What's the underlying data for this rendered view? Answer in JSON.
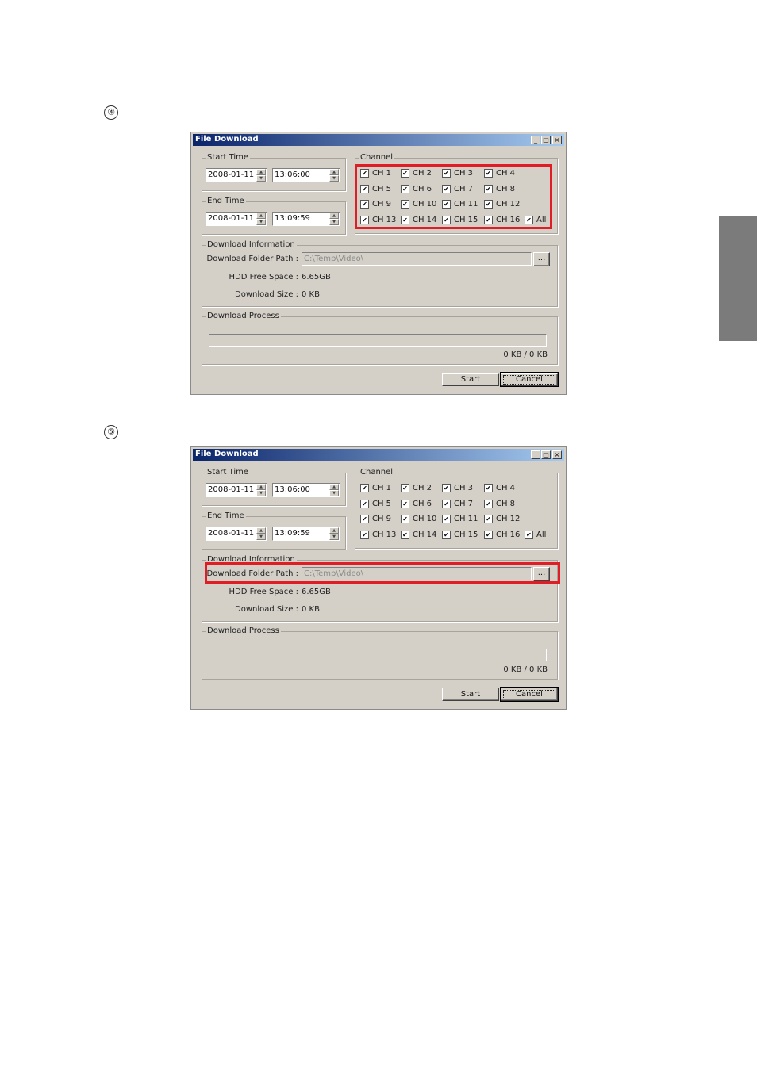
{
  "steps": [
    "④",
    "⑤"
  ],
  "dialog": {
    "title": "File Download",
    "window_buttons": [
      "_",
      "□",
      "×"
    ],
    "start_time": {
      "label": "Start Time",
      "date": "2008-01-11",
      "time": "13:06:00"
    },
    "end_time": {
      "label": "End Time",
      "date": "2008-01-11",
      "time": "13:09:59"
    },
    "channel": {
      "label": "Channel",
      "items": [
        "CH 1",
        "CH 2",
        "CH 3",
        "CH 4",
        "CH 5",
        "CH 6",
        "CH 7",
        "CH 8",
        "CH 9",
        "CH 10",
        "CH 11",
        "CH 12",
        "CH 13",
        "CH 14",
        "CH 15",
        "CH 16"
      ],
      "all_label": "All",
      "check_mark": "✔"
    },
    "download_info": {
      "label": "Download Information",
      "folder_label": "Download Folder Path :",
      "folder_value": "C:\\Temp\\Video\\",
      "browse_label": "...",
      "free_label": "HDD Free Space :",
      "free_value": "6.65GB",
      "size_label": "Download Size :",
      "size_value": "0 KB"
    },
    "download_process": {
      "label": "Download Process",
      "status": "0 KB / 0 KB"
    },
    "start_button": "Start",
    "cancel_button": "Cancel"
  },
  "colors": {
    "highlight": "#e01c24",
    "dialog_bg": "#d4d0c8",
    "title_start": "#0a246a",
    "side_tab": "#7b7b7b"
  }
}
